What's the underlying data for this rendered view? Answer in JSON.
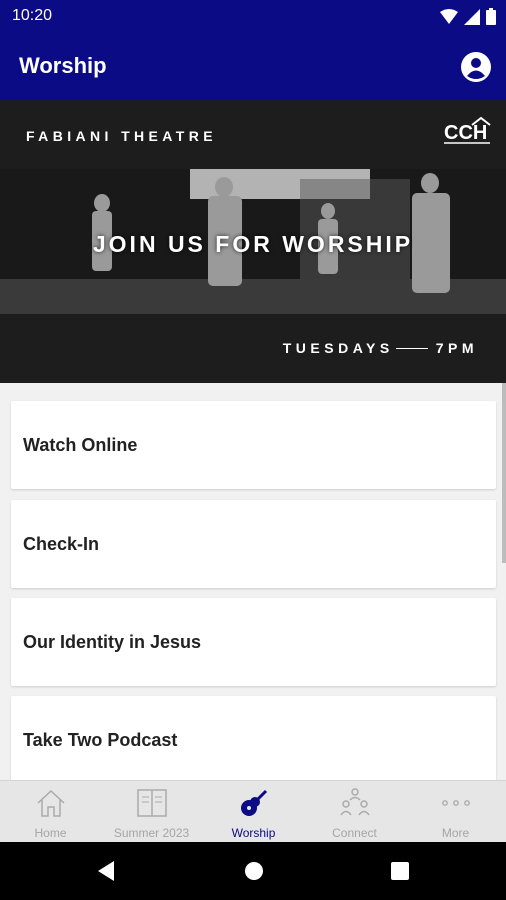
{
  "status_bar": {
    "time": "10:20"
  },
  "app_bar": {
    "title": "Worship"
  },
  "banner": {
    "venue": "FABIANI THEATRE",
    "logo_text": "CCH",
    "headline": "JOIN US FOR WORSHIP",
    "schedule_day": "TUESDAYS",
    "schedule_time": "7PM"
  },
  "list": {
    "items": [
      {
        "label": "Watch Online"
      },
      {
        "label": "Check-In"
      },
      {
        "label": "Our Identity in Jesus"
      },
      {
        "label": "Take Two Podcast"
      }
    ]
  },
  "bottom_nav": {
    "items": [
      {
        "label": "Home",
        "icon": "home-icon"
      },
      {
        "label": "Summer 2023",
        "icon": "book-icon"
      },
      {
        "label": "Worship",
        "icon": "guitar-icon",
        "active": true
      },
      {
        "label": "Connect",
        "icon": "people-icon"
      },
      {
        "label": "More",
        "icon": "more-icon"
      }
    ]
  },
  "colors": {
    "primary": "#0b0b86",
    "inactive": "#a5a5a5",
    "background": "#f1f1f1"
  }
}
